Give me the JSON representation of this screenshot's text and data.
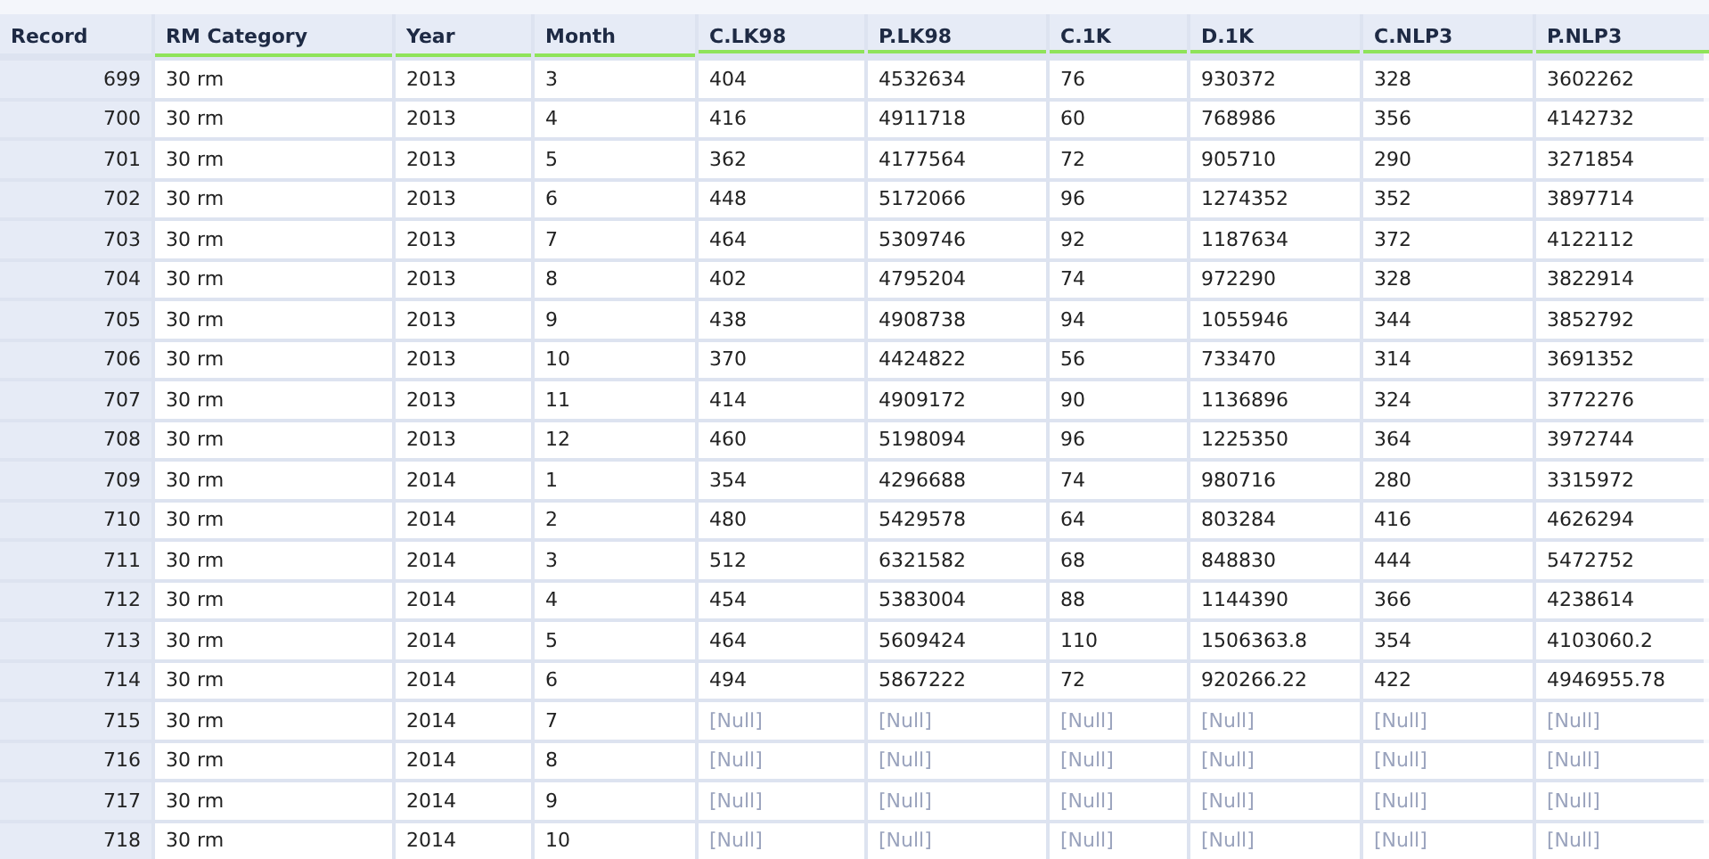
{
  "table": {
    "columns": [
      {
        "label": "Record",
        "kind": "index"
      },
      {
        "label": "RM Category",
        "kind": "string"
      },
      {
        "label": "Year",
        "kind": "string"
      },
      {
        "label": "Month",
        "kind": "string"
      },
      {
        "label": "C.LK98",
        "kind": "number"
      },
      {
        "label": "P.LK98",
        "kind": "number"
      },
      {
        "label": "C.1K",
        "kind": "number"
      },
      {
        "label": "D.1K",
        "kind": "number"
      },
      {
        "label": "C.NLP3",
        "kind": "number"
      },
      {
        "label": "P.NLP3",
        "kind": "number"
      }
    ],
    "rows": [
      [
        "699",
        "30 rm",
        "2013",
        "3",
        "404",
        "4532634",
        "76",
        "930372",
        "328",
        "3602262"
      ],
      [
        "700",
        "30 rm",
        "2013",
        "4",
        "416",
        "4911718",
        "60",
        "768986",
        "356",
        "4142732"
      ],
      [
        "701",
        "30 rm",
        "2013",
        "5",
        "362",
        "4177564",
        "72",
        "905710",
        "290",
        "3271854"
      ],
      [
        "702",
        "30 rm",
        "2013",
        "6",
        "448",
        "5172066",
        "96",
        "1274352",
        "352",
        "3897714"
      ],
      [
        "703",
        "30 rm",
        "2013",
        "7",
        "464",
        "5309746",
        "92",
        "1187634",
        "372",
        "4122112"
      ],
      [
        "704",
        "30 rm",
        "2013",
        "8",
        "402",
        "4795204",
        "74",
        "972290",
        "328",
        "3822914"
      ],
      [
        "705",
        "30 rm",
        "2013",
        "9",
        "438",
        "4908738",
        "94",
        "1055946",
        "344",
        "3852792"
      ],
      [
        "706",
        "30 rm",
        "2013",
        "10",
        "370",
        "4424822",
        "56",
        "733470",
        "314",
        "3691352"
      ],
      [
        "707",
        "30 rm",
        "2013",
        "11",
        "414",
        "4909172",
        "90",
        "1136896",
        "324",
        "3772276"
      ],
      [
        "708",
        "30 rm",
        "2013",
        "12",
        "460",
        "5198094",
        "96",
        "1225350",
        "364",
        "3972744"
      ],
      [
        "709",
        "30 rm",
        "2014",
        "1",
        "354",
        "4296688",
        "74",
        "980716",
        "280",
        "3315972"
      ],
      [
        "710",
        "30 rm",
        "2014",
        "2",
        "480",
        "5429578",
        "64",
        "803284",
        "416",
        "4626294"
      ],
      [
        "711",
        "30 rm",
        "2014",
        "3",
        "512",
        "6321582",
        "68",
        "848830",
        "444",
        "5472752"
      ],
      [
        "712",
        "30 rm",
        "2014",
        "4",
        "454",
        "5383004",
        "88",
        "1144390",
        "366",
        "4238614"
      ],
      [
        "713",
        "30 rm",
        "2014",
        "5",
        "464",
        "5609424",
        "110",
        "1506363.8",
        "354",
        "4103060.2"
      ],
      [
        "714",
        "30 rm",
        "2014",
        "6",
        "494",
        "5867222",
        "72",
        "920266.22",
        "422",
        "4946955.78"
      ],
      [
        "715",
        "30 rm",
        "2014",
        "7",
        {
          "text": "[Null]",
          "null": true
        },
        {
          "text": "[Null]",
          "null": true
        },
        {
          "text": "[Null]",
          "null": true
        },
        {
          "text": "[Null]",
          "null": true
        },
        {
          "text": "[Null]",
          "null": true
        },
        {
          "text": "[Null]",
          "null": true
        }
      ],
      [
        "716",
        "30 rm",
        "2014",
        "8",
        {
          "text": "[Null]",
          "null": true
        },
        {
          "text": "[Null]",
          "null": true
        },
        {
          "text": "[Null]",
          "null": true
        },
        {
          "text": "[Null]",
          "null": true
        },
        {
          "text": "[Null]",
          "null": true
        },
        {
          "text": "[Null]",
          "null": true
        }
      ],
      [
        "717",
        "30 rm",
        "2014",
        "9",
        {
          "text": "[Null]",
          "null": true
        },
        {
          "text": "[Null]",
          "null": true
        },
        {
          "text": "[Null]",
          "null": true
        },
        {
          "text": "[Null]",
          "null": true
        },
        {
          "text": "[Null]",
          "null": true
        },
        {
          "text": "[Null]",
          "null": true
        }
      ],
      [
        "718",
        "30 rm",
        "2014",
        "10",
        {
          "text": "[Null]",
          "null": true
        },
        {
          "text": "[Null]",
          "null": true
        },
        {
          "text": "[Null]",
          "null": true
        },
        {
          "text": "[Null]",
          "null": true
        },
        {
          "text": "[Null]",
          "null": true
        },
        {
          "text": "[Null]",
          "null": true
        }
      ]
    ]
  }
}
